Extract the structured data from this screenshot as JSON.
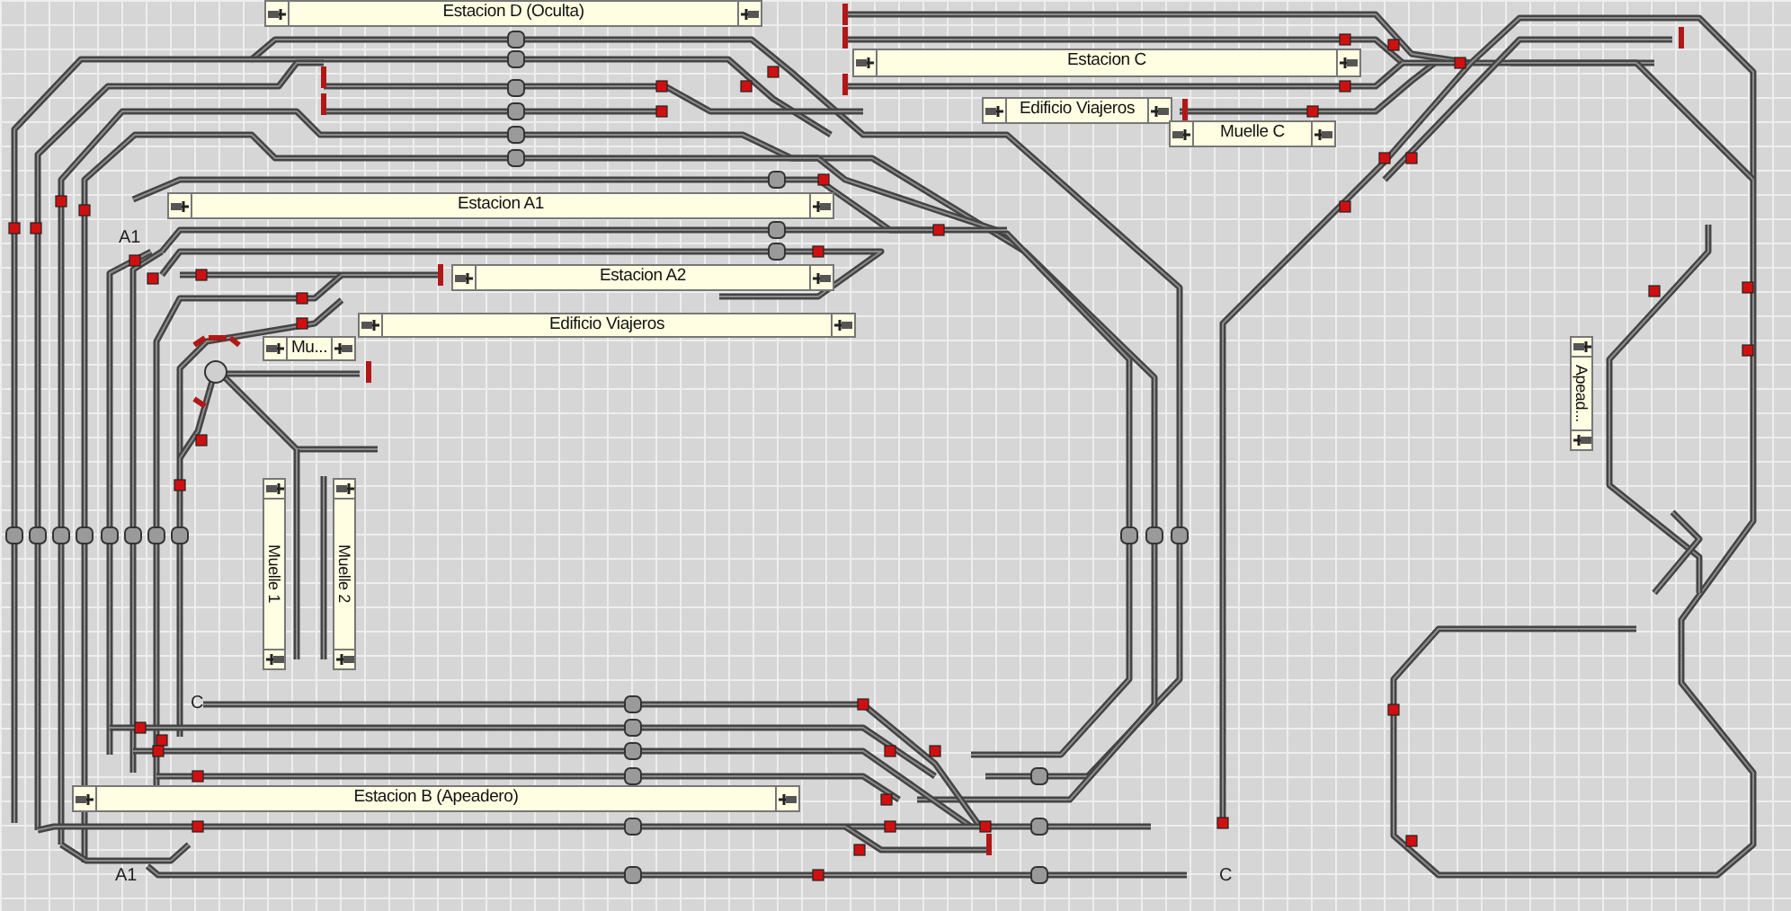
{
  "plates": [
    {
      "label": "Estacion D (Oculta)",
      "kind": "horizontal"
    },
    {
      "label": "Estacion C",
      "kind": "horizontal"
    },
    {
      "label": "Edificio Viajeros",
      "kind": "horizontal"
    },
    {
      "label": "Muelle C",
      "kind": "horizontal"
    },
    {
      "label": "Estacion A1",
      "kind": "horizontal"
    },
    {
      "label": "Estacion A2",
      "kind": "horizontal"
    },
    {
      "label": "Edificio Viajeros",
      "kind": "horizontal"
    },
    {
      "label": "Mu...",
      "kind": "horizontal"
    },
    {
      "label": "Muelle 1",
      "kind": "vertical"
    },
    {
      "label": "Muelle 2",
      "kind": "vertical"
    },
    {
      "label": "Apead...",
      "kind": "vertical"
    },
    {
      "label": "Estacion B (Apeadero)",
      "kind": "horizontal"
    }
  ],
  "markers": [
    {
      "label": "A1"
    },
    {
      "label": "C"
    },
    {
      "label": "A1"
    },
    {
      "label": "C"
    }
  ]
}
